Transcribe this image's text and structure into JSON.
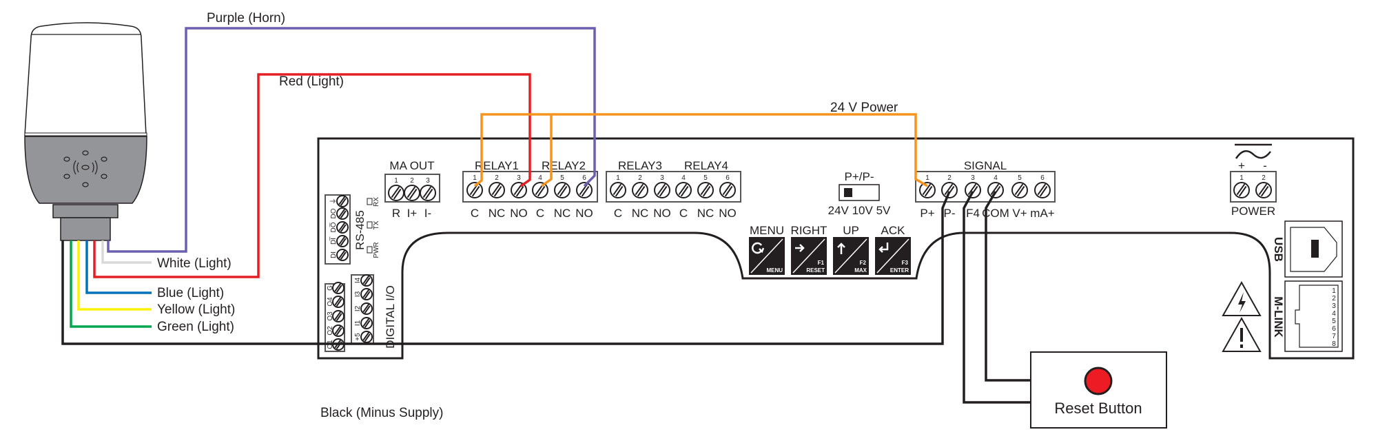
{
  "colors": {
    "purple": "#6a5fb0",
    "red": "#e31e24",
    "orange": "#f7941d",
    "blue": "#0072bc",
    "yellow": "#fff200",
    "green": "#00a650",
    "white": "#d9d9d9",
    "black": "#231f20",
    "tower_gray": "#939598"
  },
  "wires": {
    "purple": "Purple (Horn)",
    "red": "Red (Light)",
    "power": "24 V Power",
    "white": "White (Light)",
    "blue": "Blue (Light)",
    "yellow": "Yellow (Light)",
    "green": "Green (Light)",
    "black": "Black (Minus Supply)"
  },
  "ma_out": {
    "title": "MA OUT",
    "pins": [
      "1",
      "2",
      "3"
    ],
    "labels": [
      "R",
      "I+",
      "I-"
    ]
  },
  "relay12": {
    "title1": "RELAY1",
    "title2": "RELAY2",
    "pins": [
      "1",
      "2",
      "3",
      "4",
      "5",
      "6"
    ],
    "labels": [
      "C",
      "NC",
      "NO",
      "C",
      "NC",
      "NO"
    ]
  },
  "relay34": {
    "title1": "RELAY3",
    "title2": "RELAY4",
    "pins": [
      "1",
      "2",
      "3",
      "4",
      "5",
      "6"
    ],
    "labels": [
      "C",
      "NC",
      "NO",
      "C",
      "NC",
      "NO"
    ]
  },
  "signal": {
    "title": "SIGNAL",
    "pins": [
      "1",
      "2",
      "3",
      "4",
      "5",
      "6"
    ],
    "labels": [
      "P+",
      "P-",
      "F4",
      "COM",
      "V+",
      "mA+"
    ]
  },
  "power": {
    "title": "POWER",
    "pins": [
      "1",
      "2"
    ],
    "plus": "+",
    "minus": "-",
    "symbol": "ac-dc-icon"
  },
  "switch": {
    "title": "P+/P-",
    "options": "24V 10V 5V",
    "selected": "24V"
  },
  "keypad": [
    {
      "top": "MENU",
      "func": "",
      "bottom": "MENU",
      "icon": "cycle-icon"
    },
    {
      "top": "RIGHT",
      "func": "F1",
      "bottom": "RESET",
      "icon": "arrow-right-icon"
    },
    {
      "top": "UP",
      "func": "F2",
      "bottom": "MAX",
      "icon": "arrow-up-icon"
    },
    {
      "top": "ACK",
      "func": "F3",
      "bottom": "ENTER",
      "icon": "enter-icon"
    }
  ],
  "rs485": {
    "title": "RS-485",
    "terminals": [
      "DI",
      "DI̅",
      "DO̅",
      "DO",
      "⏚"
    ],
    "leds": [
      "PWR",
      "TX",
      "RX"
    ]
  },
  "digital_io": {
    "title": "DIGITAL I/O",
    "outputs": [
      "O1",
      "O2",
      "O3",
      "O4",
      "G"
    ],
    "inputs": [
      "+5",
      "I1",
      "I2",
      "I3",
      "I4"
    ]
  },
  "usb": {
    "label": "USB"
  },
  "mlink": {
    "label": "M-LINK",
    "pins": [
      "1",
      "2",
      "3",
      "4",
      "5",
      "6",
      "7",
      "8"
    ]
  },
  "reset_button": {
    "label": "Reset Button",
    "color": "#ed1c24"
  }
}
